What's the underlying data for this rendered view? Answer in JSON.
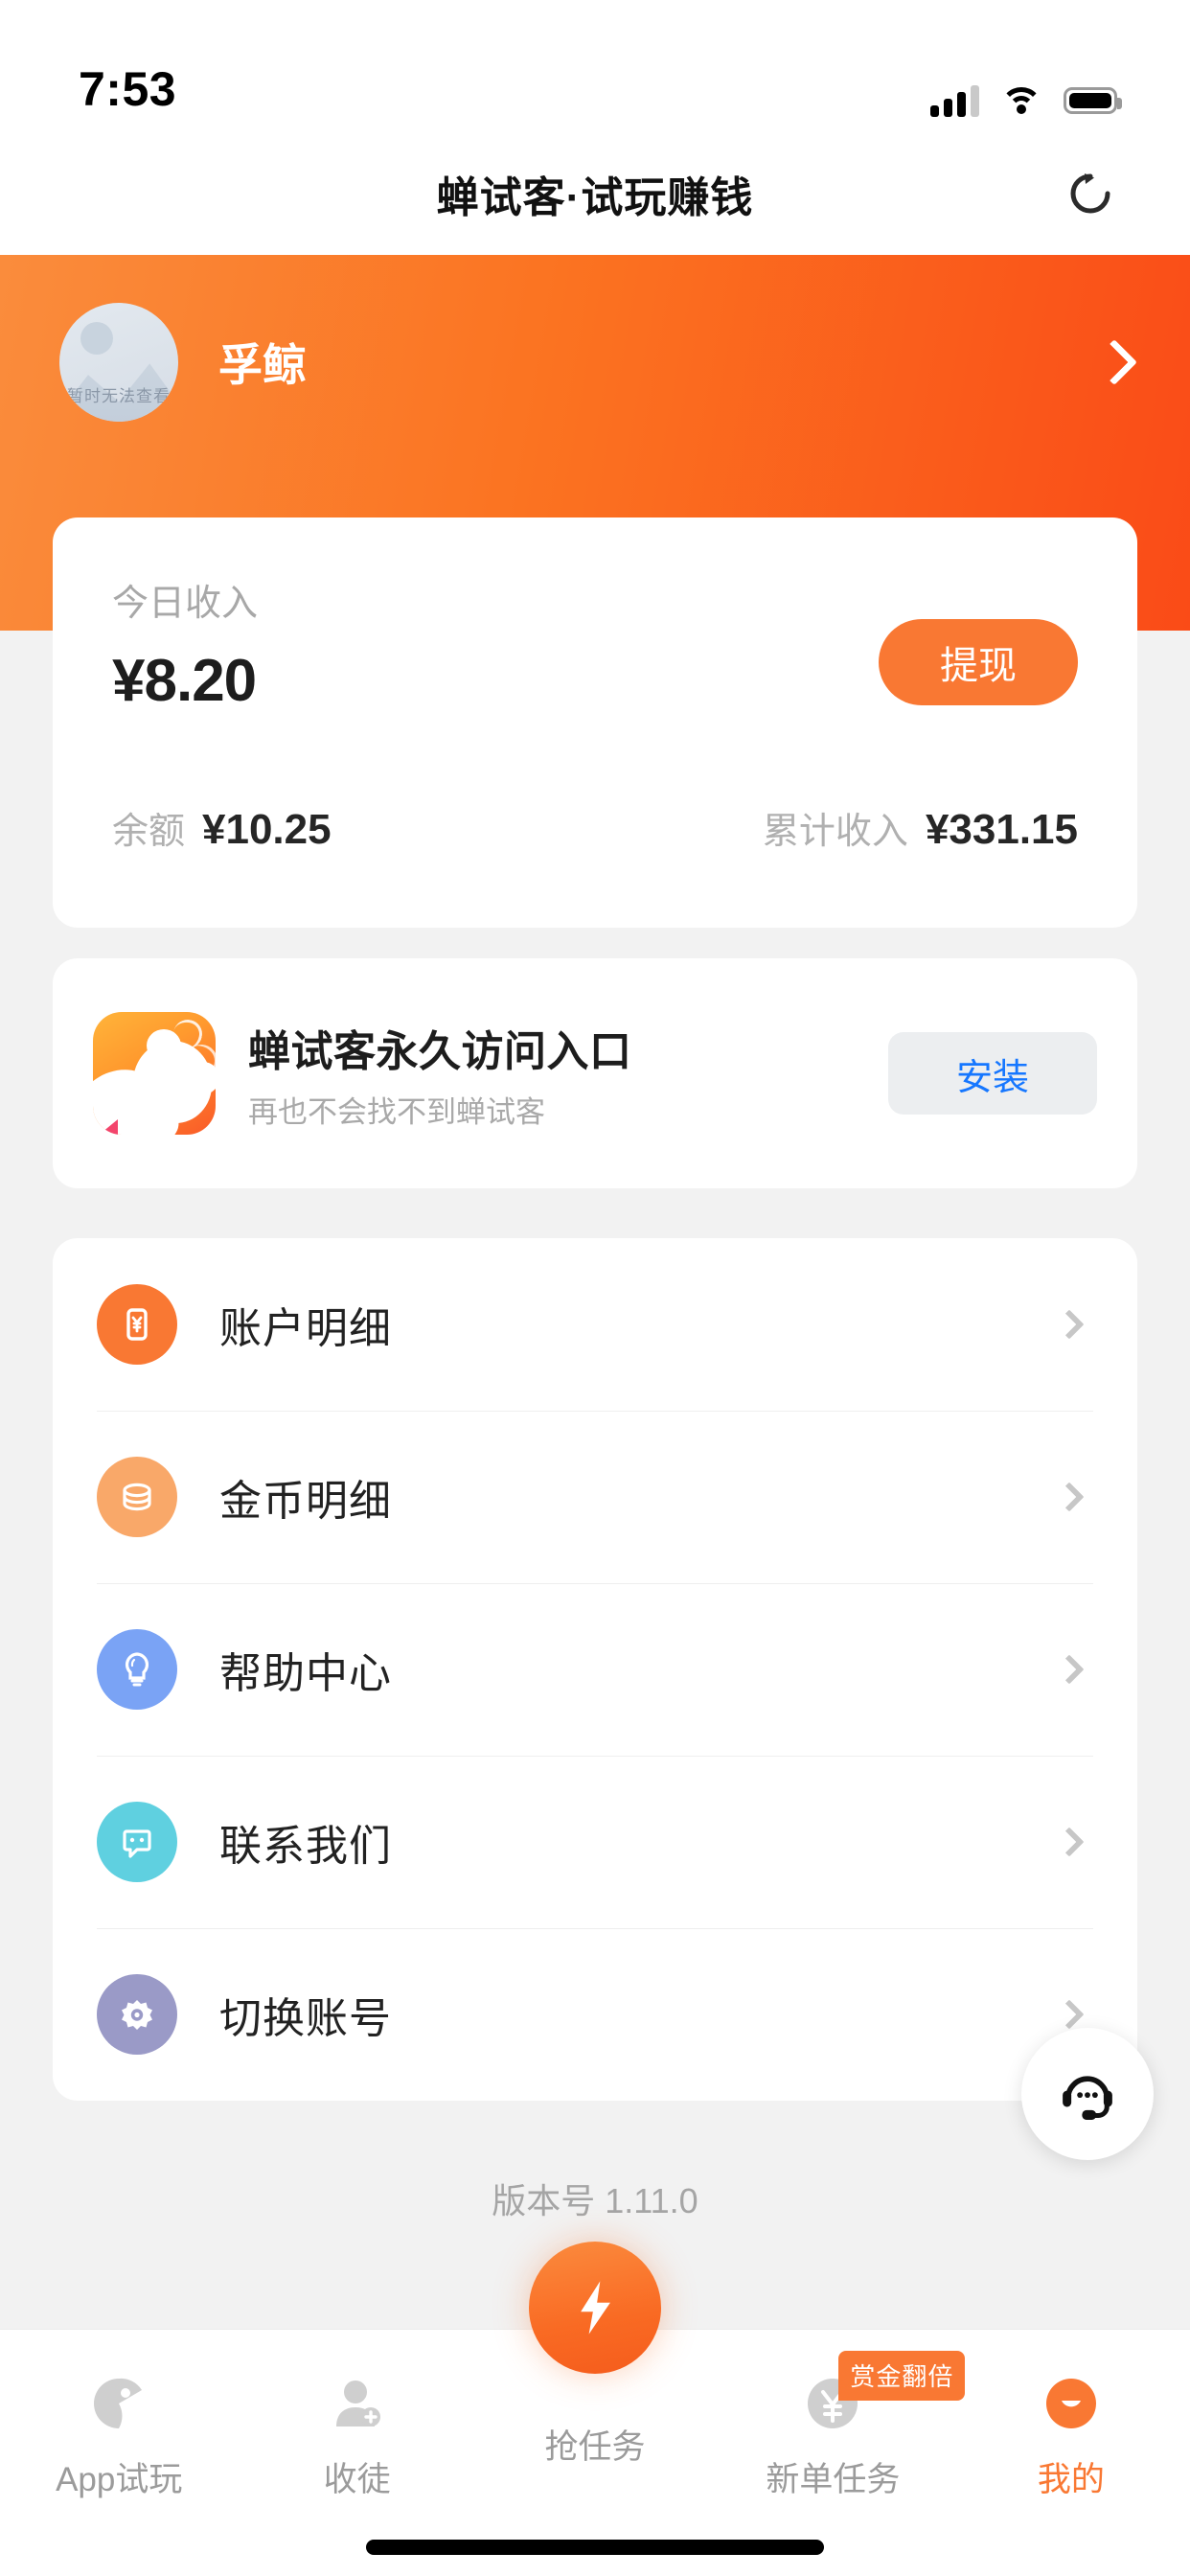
{
  "status_bar": {
    "time": "7:53",
    "signal_icon": "cellular-signal-icon",
    "wifi_icon": "wifi-icon",
    "battery_icon": "battery-icon"
  },
  "header": {
    "title": "蝉试客·试玩赚钱",
    "refresh_icon": "refresh-icon"
  },
  "profile": {
    "username": "孚鲸",
    "avatar_placeholder_text": "暂时无法查看",
    "chevron_icon": "chevron-right-icon"
  },
  "income_card": {
    "today_label": "今日收入",
    "today_amount": "¥8.20",
    "withdraw_label": "提现",
    "balance_label": "余额",
    "balance_value": "¥10.25",
    "total_label": "累计收入",
    "total_value": "¥331.15"
  },
  "install_banner": {
    "app_icon": "chanshike-app-icon",
    "title": "蝉试客永久访问入口",
    "subtitle": "再也不会找不到蝉试客",
    "button_label": "安装"
  },
  "menu": {
    "items": [
      {
        "label": "账户明细",
        "icon": "account-detail-icon",
        "color": "#f97833"
      },
      {
        "label": "金币明细",
        "icon": "coin-detail-icon",
        "color": "#f9a869"
      },
      {
        "label": "帮助中心",
        "icon": "help-bulb-icon",
        "color": "#7aa3f5"
      },
      {
        "label": "联系我们",
        "icon": "contact-chat-icon",
        "color": "#5fd0e0"
      },
      {
        "label": "切换账号",
        "icon": "switch-account-gear-icon",
        "color": "#9a9ac7"
      }
    ]
  },
  "version": {
    "text": "版本号 1.11.0"
  },
  "floating_service": {
    "icon": "customer-service-headset-icon"
  },
  "tabbar": {
    "items": [
      {
        "label": "App试玩",
        "icon": "app-trial-icon",
        "active": false
      },
      {
        "label": "收徒",
        "icon": "add-apprentice-icon",
        "active": false
      },
      {
        "label": "抢任务",
        "icon": "lightning-bolt-icon",
        "active": false,
        "center": true
      },
      {
        "label": "新单任务",
        "icon": "yuan-coin-icon",
        "active": false,
        "badge": "赏金翻倍"
      },
      {
        "label": "我的",
        "icon": "smiley-profile-icon",
        "active": true
      }
    ],
    "active_color": "#f97833",
    "inactive_color": "#9b9b9b"
  }
}
